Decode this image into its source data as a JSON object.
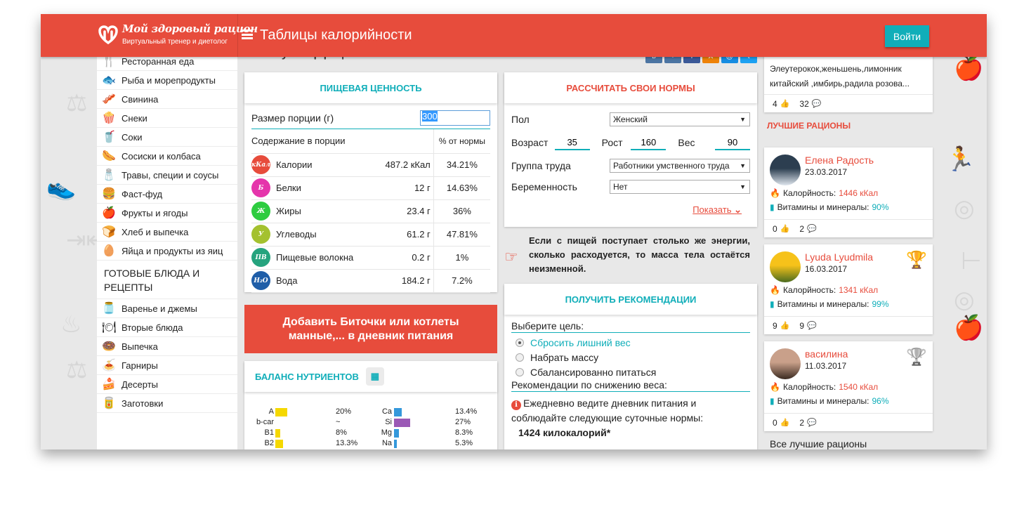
{
  "header": {
    "logo_title": "Мой здоровый рацион",
    "logo_subtitle": "Виртуальный тренер и диетолог",
    "page_title": "Таблицы калорийности",
    "login_label": "Войти"
  },
  "sidebar": {
    "items": [
      {
        "label": "Ресторанная еда",
        "icon": "restaurant-icon",
        "glyph": "🍴"
      },
      {
        "label": "Рыба и морепродукты",
        "icon": "fish-icon",
        "glyph": "🐟"
      },
      {
        "label": "Свинина",
        "icon": "bacon-icon",
        "glyph": "🥓"
      },
      {
        "label": "Снеки",
        "icon": "popcorn-icon",
        "glyph": "🍿"
      },
      {
        "label": "Соки",
        "icon": "juice-icon",
        "glyph": "🥤"
      },
      {
        "label": "Сосиски и колбаса",
        "icon": "sausage-icon",
        "glyph": "🌭"
      },
      {
        "label": "Травы, специи и соусы",
        "icon": "salt-pepper-icon",
        "glyph": "🧂"
      },
      {
        "label": "Фаст-фуд",
        "icon": "burger-icon",
        "glyph": "🍔"
      },
      {
        "label": "Фрукты и ягоды",
        "icon": "apple-icon",
        "glyph": "🍎"
      },
      {
        "label": "Хлеб и выпечка",
        "icon": "bread-icon",
        "glyph": "🍞"
      },
      {
        "label": "Яйца и продукты из яиц",
        "icon": "egg-icon",
        "glyph": "🥚"
      }
    ],
    "section_title": "ГОТОВЫЕ БЛЮДА И РЕЦЕПТЫ",
    "recipe_items": [
      {
        "label": "Варенье и джемы",
        "icon": "jam-jar-icon",
        "glyph": "🫙"
      },
      {
        "label": "Вторые блюда",
        "icon": "main-dish-icon",
        "glyph": "🍽"
      },
      {
        "label": "Выпечка",
        "icon": "bagel-icon",
        "glyph": "🍩"
      },
      {
        "label": "Гарниры",
        "icon": "side-dish-icon",
        "glyph": "🍝"
      },
      {
        "label": "Десерты",
        "icon": "cake-icon",
        "glyph": "🍰"
      },
      {
        "label": "Заготовки",
        "icon": "preserves-jar-icon",
        "glyph": "🥫"
      }
    ]
  },
  "page_heading": "Калькулятор рецепта",
  "nutrition": {
    "title": "ПИЩЕВАЯ ЦЕННОСТЬ",
    "portion_label": "Размер порции (г)",
    "portion_value": "300",
    "col_content": "Содержание в порции",
    "col_percent": "% от нормы",
    "rows": [
      {
        "badge": "кКал",
        "color": "#e74c3c",
        "name": "Калории",
        "value": "487.2 кКал",
        "percent": "34.21%"
      },
      {
        "badge": "Б",
        "color": "#e535ab",
        "name": "Белки",
        "value": "12 г",
        "percent": "14.63%"
      },
      {
        "badge": "Ж",
        "color": "#2ecc40",
        "name": "Жиры",
        "value": "23.4 г",
        "percent": "36%"
      },
      {
        "badge": "У",
        "color": "#a4c12f",
        "name": "Углеводы",
        "value": "61.2 г",
        "percent": "47.81%"
      },
      {
        "badge": "ПВ",
        "color": "#26a37e",
        "name": "Пищевые волокна",
        "value": "0.2 г",
        "percent": "1%"
      },
      {
        "badge": "H₂O",
        "color": "#1f5ea8",
        "name": "Вода",
        "value": "184.2 г",
        "percent": "7.2%"
      }
    ]
  },
  "add_button_label": "Добавить Биточки или котлеты манные,... в дневник питания",
  "balance": {
    "title": "БАЛАНС НУТРИЕНТОВ",
    "vitamins": [
      {
        "name": "A",
        "percent": "20%",
        "value": 20,
        "color": "#f5d800"
      },
      {
        "name": "b-car",
        "percent": "~",
        "value": 0,
        "color": "#f5d800"
      },
      {
        "name": "B1",
        "percent": "8%",
        "value": 8,
        "color": "#f5d800"
      },
      {
        "name": "B2",
        "percent": "13.3%",
        "value": 13.3,
        "color": "#f5d800"
      }
    ],
    "minerals": [
      {
        "name": "Ca",
        "percent": "13.4%",
        "value": 13.4,
        "color": "#3498db"
      },
      {
        "name": "Si",
        "percent": "27%",
        "value": 27,
        "color": "#9b59b6"
      },
      {
        "name": "Mg",
        "percent": "8.3%",
        "value": 8.3,
        "color": "#3498db"
      },
      {
        "name": "Na",
        "percent": "5.3%",
        "value": 5.3,
        "color": "#3498db"
      }
    ]
  },
  "share": [
    {
      "icon": "vk-icon",
      "glyph": "в",
      "color": "#4c75a3"
    },
    {
      "icon": "google-plus-icon",
      "glyph": "+",
      "color": "#4c75a3"
    },
    {
      "icon": "facebook-icon",
      "glyph": "f",
      "color": "#3b5998"
    },
    {
      "icon": "odnoklassniki-icon",
      "glyph": "✕",
      "color": "#ee8208"
    },
    {
      "icon": "mailru-icon",
      "glyph": "@",
      "color": "#168de2"
    },
    {
      "icon": "twitter-icon",
      "glyph": "t",
      "color": "#1da1f2"
    }
  ],
  "norms": {
    "title": "РАССЧИТАТЬ СВОИ НОРМЫ",
    "sex_label": "Пол",
    "sex_value": "Женский",
    "age_label": "Возраст",
    "age_value": "35",
    "height_label": "Рост",
    "height_value": "160",
    "weight_label": "Вес",
    "weight_value": "90",
    "work_label": "Группа труда",
    "work_value": "Работники умственного труда",
    "pregnancy_label": "Беременность",
    "pregnancy_value": "Нет",
    "show_label": "Показать"
  },
  "tip_text": "Если с пищей поступает столько же энергии, сколько расходуется, то масса тела остаётся неизменной.",
  "recommendations": {
    "title": "ПОЛУЧИТЬ РЕКОМЕНДАЦИИ",
    "goal_label": "Выберите цель:",
    "goals": [
      {
        "label": "Сбросить лишний вес",
        "selected": true
      },
      {
        "label": "Набрать массу",
        "selected": false
      },
      {
        "label": "Сбалансированно питаться",
        "selected": false
      }
    ],
    "advice_label": "Рекомендации по снижению веса:",
    "advice_text": "Ежедневно ведите дневник питания и соблюдайте следующие суточные нормы:",
    "kcal_norm": "1424 килокалорий*"
  },
  "right": {
    "top_card": {
      "text": "Элеутерокок,женьшень,лимонник китайский ,имбирь,радила розова...",
      "likes": "4",
      "comments": "32"
    },
    "best_title": "ЛУЧШИЕ РАЦИОНЫ",
    "diets": [
      {
        "name": "Елена Радость",
        "date": "23.03.2017",
        "kcal_label": "Калорйность:",
        "kcal": "1446 кКал",
        "vit_label": "Витамины и минералы:",
        "vit": "90%",
        "likes": "0",
        "comments": "2",
        "trophy": "",
        "avatar_colors": [
          "#2c3e50",
          "#dfe6ee"
        ]
      },
      {
        "name": "Lyuda Lyudmila",
        "date": "16.03.2017",
        "kcal_label": "Калорйность:",
        "kcal": "1341 кКал",
        "vit_label": "Витамины и минералы:",
        "vit": "99%",
        "likes": "9",
        "comments": "9",
        "trophy": "gold",
        "avatar_colors": [
          "#f6c21a",
          "#4a6b1f"
        ]
      },
      {
        "name": "василина",
        "date": "11.03.2017",
        "kcal_label": "Калорйность:",
        "kcal": "1540 кКал",
        "vit_label": "Витамины и минералы:",
        "vit": "96%",
        "likes": "0",
        "comments": "2",
        "trophy": "silver",
        "avatar_colors": [
          "#c9a08a",
          "#3a2a20"
        ]
      }
    ],
    "all_best_label": "Все лучшие рационы"
  }
}
